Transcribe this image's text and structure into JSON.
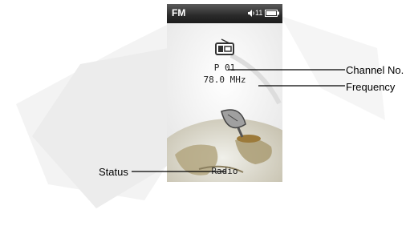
{
  "screen": {
    "mode": "FM",
    "volume": "11",
    "channel": "P 01",
    "frequency": "78.0 MHz",
    "status": "Radio"
  },
  "callouts": {
    "channel_label": "Channel No.",
    "frequency_label": "Frequency",
    "status_label": "Status"
  },
  "icons": [
    "speaker-icon",
    "battery-icon",
    "radio-icon",
    "satellite-dish-icon",
    "globe-graphic"
  ],
  "colors": {
    "topbar": "#2a2a2a",
    "screen_background": "#f2f2f2",
    "globe_land": "#9a8a60"
  }
}
